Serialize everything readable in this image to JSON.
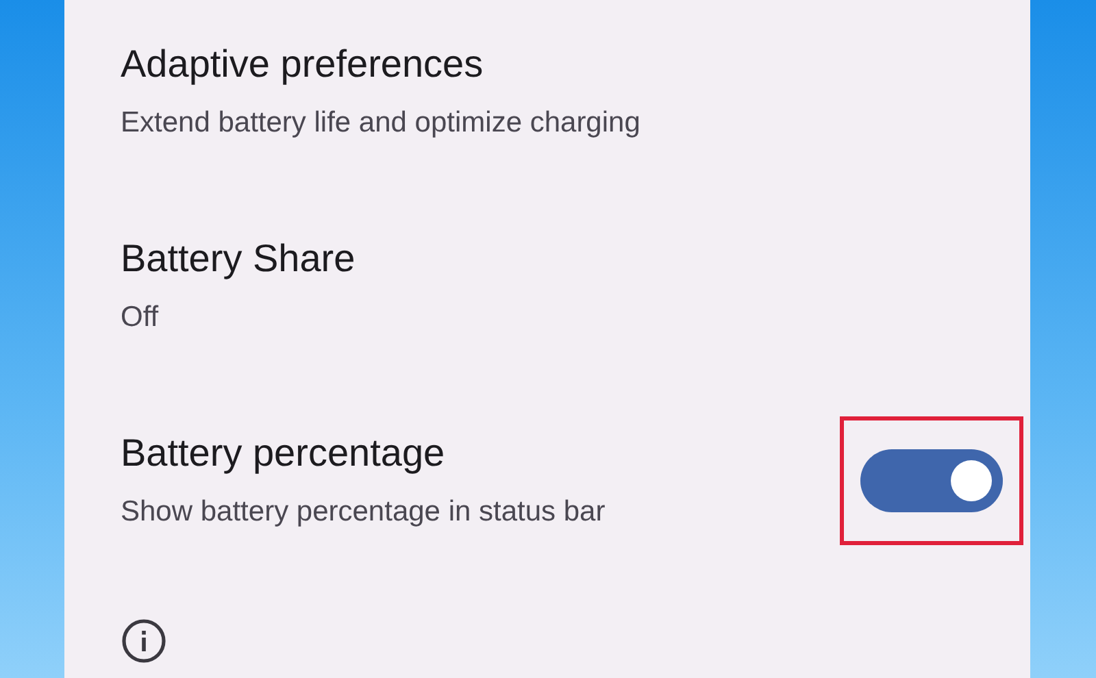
{
  "settings": [
    {
      "title": "Adaptive preferences",
      "summary": "Extend battery life and optimize charging",
      "kind": "link"
    },
    {
      "title": "Battery Share",
      "summary": "Off",
      "kind": "link"
    },
    {
      "title": "Battery percentage",
      "summary": "Show battery percentage in status bar",
      "kind": "switch",
      "on": true,
      "highlighted": true
    }
  ],
  "footer": {
    "kind": "info"
  }
}
